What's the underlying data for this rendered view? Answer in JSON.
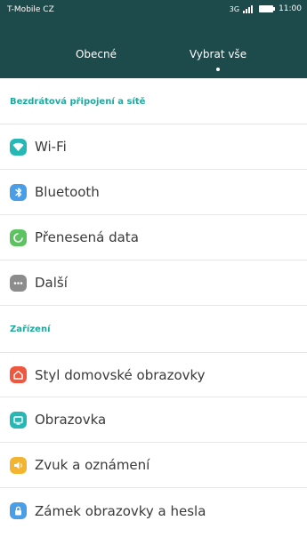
{
  "status_bar": {
    "carrier": "T-Mobile CZ",
    "network_type": "3G",
    "time": "11:00"
  },
  "tabs": [
    {
      "label": "Obecné"
    },
    {
      "label": "Vybrat vše"
    }
  ],
  "sections": [
    {
      "title": "Bezdrátová připojení a sítě",
      "items": [
        {
          "label": "Wi-Fi",
          "icon": "wifi-icon",
          "color": "#27b8b5"
        },
        {
          "label": "Bluetooth",
          "icon": "bluetooth-icon",
          "color": "#4a9ee8"
        },
        {
          "label": "Přenesená data",
          "icon": "data-usage-icon",
          "color": "#5cc360"
        },
        {
          "label": "Další",
          "icon": "more-icon",
          "color": "#8c8c8c"
        }
      ]
    },
    {
      "title": "Zařízení",
      "items": [
        {
          "label": "Styl domovské obrazovky",
          "icon": "home-icon",
          "color": "#f0573f"
        },
        {
          "label": "Obrazovka",
          "icon": "display-icon",
          "color": "#27b8b5"
        },
        {
          "label": "Zvuk a oznámení",
          "icon": "sound-icon",
          "color": "#f3b531"
        },
        {
          "label": "Zámek obrazovky a hesla",
          "icon": "lock-icon",
          "color": "#4a9ee8"
        }
      ]
    }
  ],
  "colors": {
    "header_bg": "#1d4a4b",
    "section_title": "#21a89e"
  }
}
